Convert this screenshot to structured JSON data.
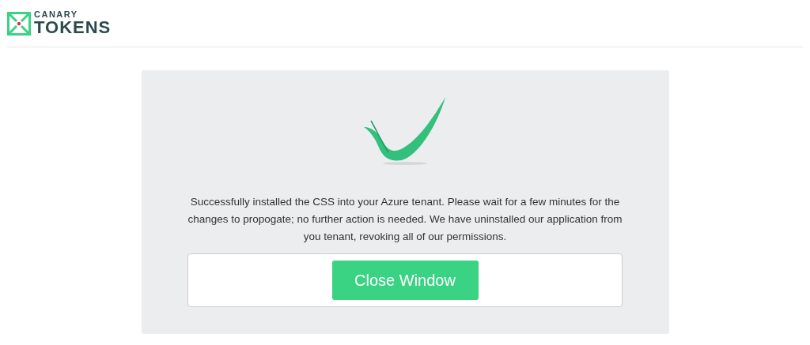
{
  "logo": {
    "top": "CANARY",
    "bottom": "TOKENS"
  },
  "message": "Successfully installed the CSS into your Azure tenant. Please wait for a few minutes for the changes to propogate; no further action is needed. We have uninstalled our application from you tenant, revoking all of our permissions.",
  "button": "Close Window"
}
